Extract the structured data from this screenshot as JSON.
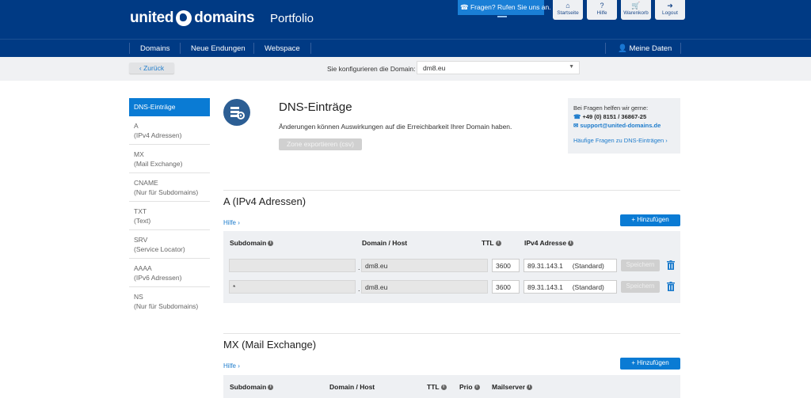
{
  "header": {
    "brand_left": "united",
    "brand_right": "domains",
    "section": "Portfolio",
    "call": "Fragen? Rufen Sie uns an.",
    "buttons": [
      {
        "label": "Startseite",
        "icon": "⌂"
      },
      {
        "label": "Hilfe",
        "icon": "?"
      },
      {
        "label": "Warenkorb",
        "icon": "🛒"
      },
      {
        "label": "Logout",
        "icon": "➜"
      }
    ]
  },
  "nav": {
    "items": [
      "Domains",
      "Neue Endungen",
      "Webspace"
    ],
    "account": "Meine Daten"
  },
  "toolbar": {
    "back": "‹ Zurück",
    "domain_label": "Sie konfigurieren die Domain:",
    "domain_value": "dm8.eu"
  },
  "sidebar": {
    "items": [
      {
        "t": "DNS-Einträge",
        "s": ""
      },
      {
        "t": "A",
        "s": "(IPv4 Adressen)"
      },
      {
        "t": "MX",
        "s": "(Mail Exchange)"
      },
      {
        "t": "CNAME",
        "s": "(Nur für Subdomains)"
      },
      {
        "t": "TXT",
        "s": "(Text)"
      },
      {
        "t": "SRV",
        "s": "(Service Locator)"
      },
      {
        "t": "AAAA",
        "s": "(IPv6 Adressen)"
      },
      {
        "t": "NS",
        "s": "(Nur für Subdomains)"
      }
    ]
  },
  "main": {
    "title": "DNS-Einträge",
    "subtitle": "Änderungen können Auswirkungen auf die Erreichbarkeit Ihrer Domain haben.",
    "export": "Zone exportieren (csv)"
  },
  "help": {
    "intro": "Bei Fragen helfen wir gerne:",
    "phone": "+49 (0) 8151 / 36867-25",
    "email": "support@united-domains.de",
    "faq": "Häufige Fragen zu DNS-Einträgen ›"
  },
  "a_section": {
    "title": "A (IPv4 Adressen)",
    "hilfe": "Hilfe ›",
    "add": "+ Hinzufügen",
    "headers": [
      "Subdomain",
      "Domain / Host",
      "TTL",
      "IPv4 Adresse"
    ],
    "rows": [
      {
        "sub": "",
        "host": "dm8.eu",
        "ttl": "3600",
        "ip": "89.31.143.1",
        "std": "(Standard)",
        "save": "Speichern"
      },
      {
        "sub": "*",
        "host": "dm8.eu",
        "ttl": "3600",
        "ip": "89.31.143.1",
        "std": "(Standard)",
        "save": "Speichern"
      }
    ]
  },
  "mx_section": {
    "title": "MX (Mail Exchange)",
    "hilfe": "Hilfe ›",
    "add": "+ Hinzufügen",
    "headers": [
      "Subdomain",
      "Domain / Host",
      "TTL",
      "Prio",
      "Mailserver"
    ]
  }
}
